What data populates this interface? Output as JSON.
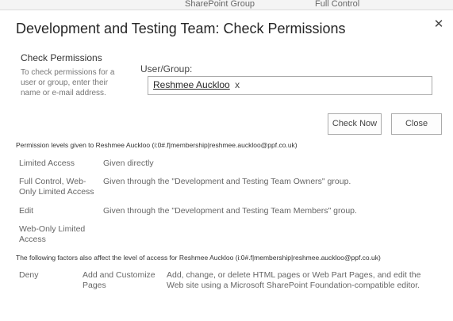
{
  "backdrop": {
    "col_a": "SharePoint Group",
    "col_b": "Full Control"
  },
  "dialog": {
    "title": "Development and Testing Team: Check Permissions",
    "close_icon": "close-icon"
  },
  "check_section": {
    "heading": "Check Permissions",
    "description": "To check permissions for a user or group, enter their name or e-mail address."
  },
  "user_group": {
    "label": "User/Group:",
    "resolved_name": "Reshmee Auckloo",
    "remove_glyph": "x"
  },
  "buttons": {
    "check_now": "Check Now",
    "close": "Close"
  },
  "permissions": {
    "caption": "Permission levels given to Reshmee Auckloo (i:0#.f|membership|reshmee.auckloo@ppf.co.uk)",
    "rows": [
      {
        "level": "Limited Access",
        "source": "Given directly"
      },
      {
        "level": "Full Control, Web-Only Limited Access",
        "source": "Given through the \"Development and Testing Team Owners\" group."
      },
      {
        "level": "Edit",
        "source": "Given through the \"Development and Testing Team Members\" group."
      },
      {
        "level": "Web-Only Limited Access",
        "source": ""
      }
    ]
  },
  "factors": {
    "caption": "The following factors also affect the level of access for Reshmee Auckloo (i:0#.f|membership|reshmee.auckloo@ppf.co.uk)",
    "rows": [
      {
        "type": "Deny",
        "permission": "Add and Customize Pages",
        "description": "Add, change, or delete HTML pages or Web Part Pages, and edit the Web site using a Microsoft SharePoint Foundation-compatible editor."
      }
    ]
  }
}
